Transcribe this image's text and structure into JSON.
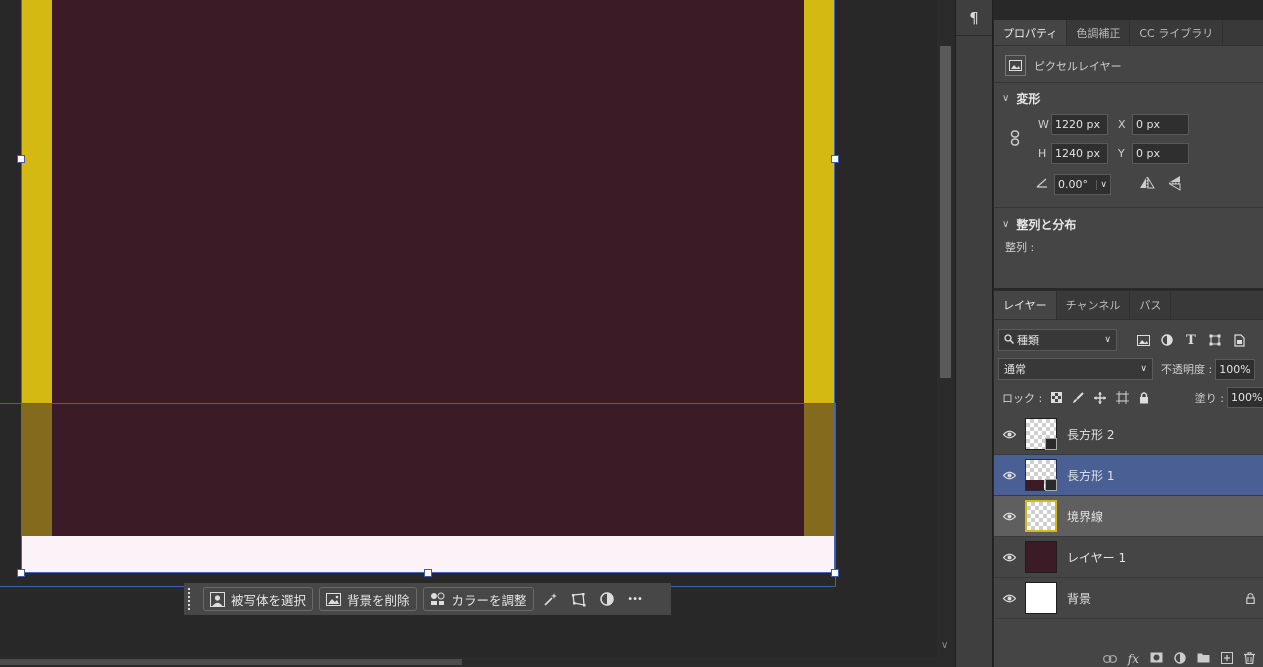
{
  "contextual_taskbar": {
    "select_subject": "被写体を選択",
    "remove_background": "背景を削除",
    "adjust_color": "カラーを調整",
    "more": "•••"
  },
  "dock": {
    "paragraph_glyph": "¶"
  },
  "properties_panel": {
    "tabs": [
      "プロパティ",
      "色調補正",
      "CC ライブラリ"
    ],
    "layer_type": "ピクセルレイヤー",
    "transform": {
      "title": "変形",
      "w_label": "W",
      "w_value": "1220 px",
      "x_label": "X",
      "x_value": "0 px",
      "h_label": "H",
      "h_value": "1240 px",
      "y_label": "Y",
      "y_value": "0 px",
      "angle_value": "0.00°"
    },
    "align": {
      "title": "整列と分布",
      "label": "整列 :"
    }
  },
  "layers_panel": {
    "tabs": [
      "レイヤー",
      "チャンネル",
      "パス"
    ],
    "filter_kind": "種類",
    "blend_mode": "通常",
    "opacity_label": "不透明度 :",
    "opacity_value": "100%",
    "lock_label": "ロック :",
    "fill_label": "塗り :",
    "fill_value": "100%",
    "layers": [
      {
        "name": "長方形 2",
        "selected": false
      },
      {
        "name": "長方形 1",
        "selected": true
      },
      {
        "name": "境界線",
        "selected": false
      },
      {
        "name": "レイヤー 1",
        "selected": false
      },
      {
        "name": "背景",
        "selected": false,
        "locked": true
      }
    ]
  },
  "colors": {
    "document_bg": "#3b1b25",
    "yellow_bar": "#d4b913",
    "selected_layer": "#4a5f93",
    "hover_layer": "#606060"
  }
}
